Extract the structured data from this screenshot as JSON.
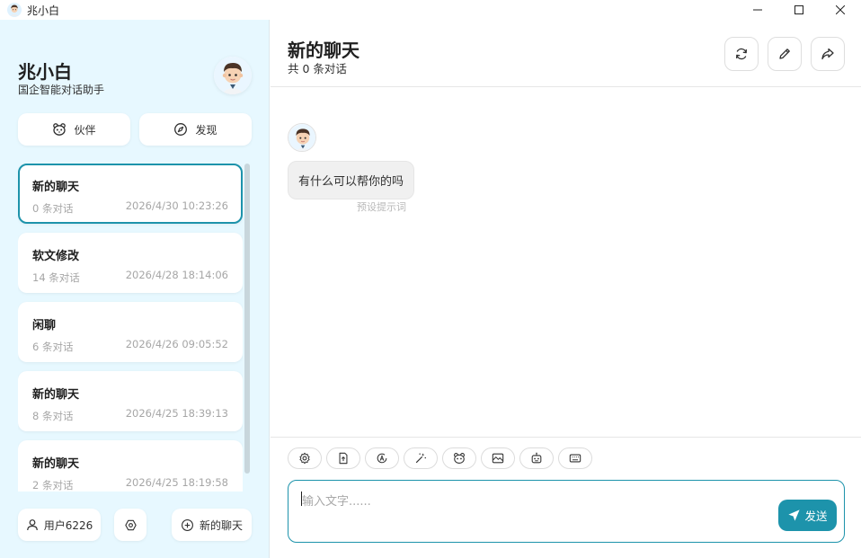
{
  "window": {
    "title": "兆小白",
    "icon": "avatar-icon"
  },
  "sidebar": {
    "brand_title": "兆小白",
    "brand_subtitle": "国企智能对话助手",
    "partner_label": "伙伴",
    "discover_label": "发现",
    "chats": [
      {
        "title": "新的聊天",
        "count": "0 条对话",
        "time": "2026/4/30 10:23:26",
        "selected": true
      },
      {
        "title": "软文修改",
        "count": "14 条对话",
        "time": "2026/4/28 18:14:06"
      },
      {
        "title": "闲聊",
        "count": "6 条对话",
        "time": "2026/4/26 09:05:52"
      },
      {
        "title": "新的聊天",
        "count": "8 条对话",
        "time": "2026/4/25 18:39:13"
      },
      {
        "title": "新的聊天",
        "count": "2 条对话",
        "time": "2026/4/25 18:19:58"
      }
    ],
    "user_label": "用户6226",
    "new_chat_label": "新的聊天"
  },
  "main": {
    "title": "新的聊天",
    "subtitle": "共 0 条对话",
    "message": "有什么可以帮你的吗",
    "message_note": "预设提示词",
    "input_placeholder": "输入文字......",
    "send_label": "发送"
  },
  "colors": {
    "accent": "#1d93ab",
    "sidebar_bg": "#e7f8ff"
  }
}
